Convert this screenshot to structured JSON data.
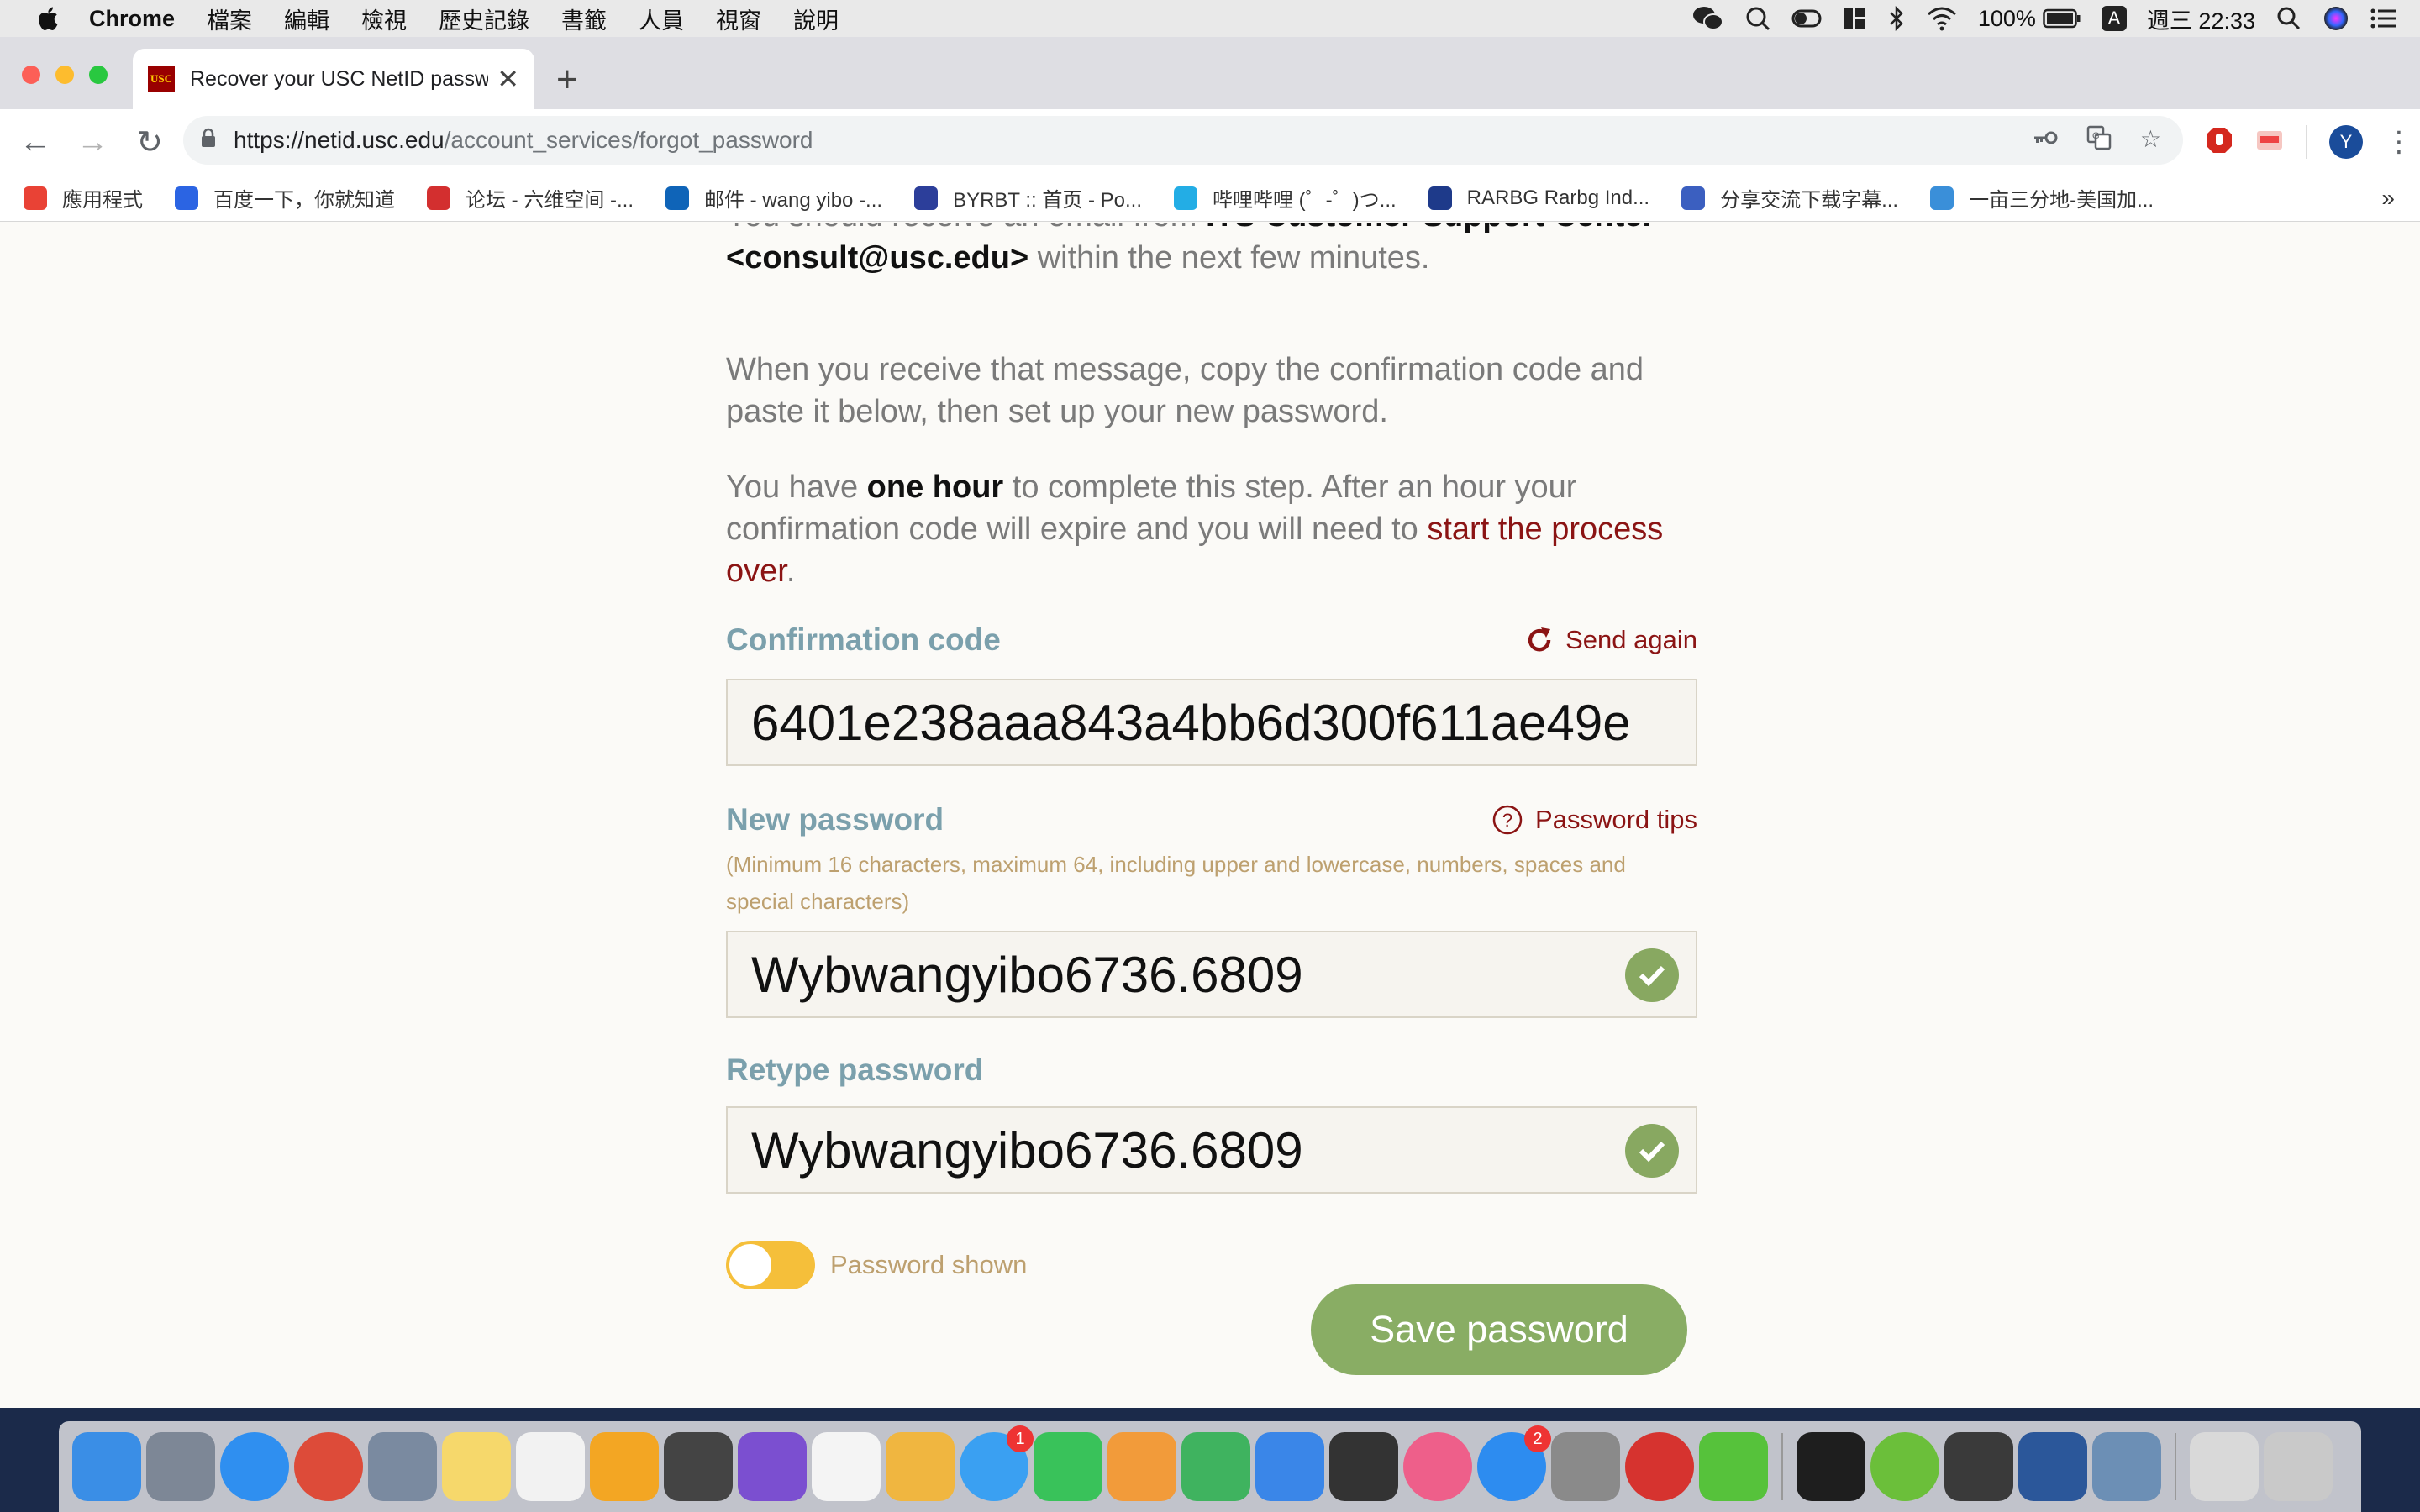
{
  "menubar": {
    "items": [
      "Chrome",
      "檔案",
      "編輯",
      "檢視",
      "歷史記錄",
      "書籤",
      "人員",
      "視窗",
      "說明"
    ],
    "battery": "100%",
    "input_indicator": "A",
    "clock": "週三 22:33"
  },
  "browser": {
    "tab_title": "Recover your USC NetID password",
    "tab_favicon_text": "USC",
    "url_host": "https://netid.usc.edu",
    "url_path": "/account_services/forgot_password",
    "profile_initial": "Y",
    "bookmarks": [
      {
        "label": "應用程式",
        "icon": "apps-grid-icon",
        "color": "#e94235"
      },
      {
        "label": "百度一下，你就知道",
        "icon": "baidu-paw-icon",
        "color": "#2b64e3"
      },
      {
        "label": "论坛 - 六维空间 -...",
        "icon": "liuwei-logo-icon",
        "color": "#d32f2f"
      },
      {
        "label": "邮件 - wang yibo -...",
        "icon": "outlook-icon",
        "color": "#0f64b8"
      },
      {
        "label": "BYRBT :: 首页 - Po...",
        "icon": "butterfly-icon",
        "color": "#2c3e9a"
      },
      {
        "label": "哔哩哔哩 (゜-゜)つ...",
        "icon": "bilibili-tv-icon",
        "color": "#23ade5"
      },
      {
        "label": "RARBG Rarbg Ind...",
        "icon": "rarbg-r-icon",
        "color": "#1e3a8a"
      },
      {
        "label": "分享交流下载字幕...",
        "icon": "subtitle-s-icon",
        "color": "#3b5fc0"
      },
      {
        "label": "一亩三分地-美国加...",
        "icon": "1point3acres-icon",
        "color": "#3a8fd9"
      }
    ]
  },
  "page": {
    "intro_line1_partial": "You should receive an email from ",
    "intro_sender_partial": "ITS Customer Support Center",
    "intro_email": "<consult@usc.edu>",
    "intro_line2_rest": " within the next few minutes.",
    "para2": "When you receive that message, copy the confirmation code and paste it below, then set up your new password.",
    "para3_a": "You have ",
    "para3_b": "one hour",
    "para3_c": " to complete this step. After an hour your confirmation code will expire and you will need to ",
    "para3_link": "start the process over",
    "para3_d": ".",
    "confirmation": {
      "label": "Confirmation code",
      "send_again": "Send again",
      "value": "6401e238aaa843a4bb6d300f611ae49e"
    },
    "new_password": {
      "label": "New password",
      "tips": "Password tips",
      "hint": "(Minimum 16 characters, maximum 64, including upper and lowercase, numbers, spaces and special characters)",
      "value": "Wybwangyibo6736.6809"
    },
    "retype_password": {
      "label": "Retype password",
      "value": "Wybwangyibo6736.6809"
    },
    "toggle_label": "Password shown",
    "save_button": "Save password"
  },
  "dock": {
    "apps": [
      {
        "name": "finder-icon",
        "color": "#3a8ee6"
      },
      {
        "name": "launchpad-icon",
        "color": "#7d8796"
      },
      {
        "name": "safari-icon",
        "color": "#2f8ff0"
      },
      {
        "name": "chrome-icon",
        "color": "#dd4b39"
      },
      {
        "name": "mail-eagle-icon",
        "color": "#7a8aa0"
      },
      {
        "name": "notes-icon",
        "color": "#f6d86b"
      },
      {
        "name": "ia-writer-icon",
        "color": "#f2f2f2"
      },
      {
        "name": "tes-butterfly-icon",
        "color": "#f3a623"
      },
      {
        "name": "vectorworks-icon",
        "color": "#444444"
      },
      {
        "name": "omnifocus-icon",
        "color": "#7b4fd0"
      },
      {
        "name": "reminders-icon",
        "color": "#f4f4f4"
      },
      {
        "name": "photos-icon",
        "color": "#f0b640"
      },
      {
        "name": "messages-icon",
        "color": "#3aa0f2",
        "badge": "1"
      },
      {
        "name": "facetime-icon",
        "color": "#39c25a"
      },
      {
        "name": "pages-icon",
        "color": "#f29b3a"
      },
      {
        "name": "numbers-icon",
        "color": "#3fb35f"
      },
      {
        "name": "keynote-icon",
        "color": "#3a86e8"
      },
      {
        "name": "final-cut-icon",
        "color": "#333333"
      },
      {
        "name": "itunes-icon",
        "color": "#ee5f8a"
      },
      {
        "name": "app-store-icon",
        "color": "#2d8cf0",
        "badge": "2"
      },
      {
        "name": "system-preferences-icon",
        "color": "#8a8a8a"
      },
      {
        "name": "netease-music-icon",
        "color": "#d6332f"
      },
      {
        "name": "wechat-icon",
        "color": "#56c23b"
      },
      {
        "name": "pycharm-icon",
        "color": "#1e1e1e"
      },
      {
        "name": "utorrent-icon",
        "color": "#6bbf3a"
      },
      {
        "name": "sublime-text-icon",
        "color": "#3a3a3a"
      },
      {
        "name": "word-icon",
        "color": "#2b579a"
      },
      {
        "name": "preview-icon",
        "color": "#6c8fb5"
      },
      {
        "name": "documents-folder-icon",
        "color": "#d9d9d9"
      },
      {
        "name": "trash-icon",
        "color": "#c9c9c9"
      }
    ]
  }
}
